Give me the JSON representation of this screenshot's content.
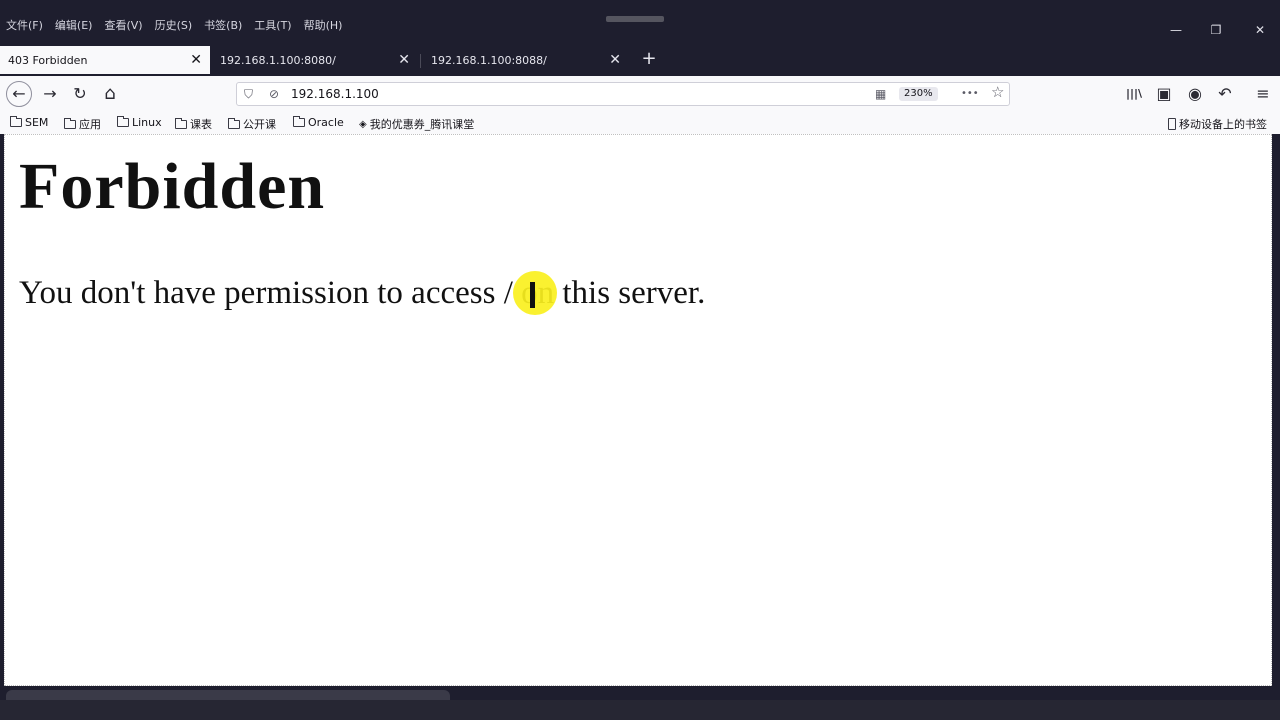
{
  "menu": {
    "items": [
      "文件(F)",
      "编辑(E)",
      "查看(V)",
      "历史(S)",
      "书签(B)",
      "工具(T)",
      "帮助(H)"
    ]
  },
  "window_controls": {
    "minimize": "—",
    "restore": "❐",
    "close": "✕"
  },
  "tabs": [
    {
      "label": "403 Forbidden",
      "active": true
    },
    {
      "label": "192.168.1.100:8080/",
      "active": false
    },
    {
      "label": "192.168.1.100:8088/",
      "active": false
    }
  ],
  "tab_close_glyph": "✕",
  "new_tab_glyph": "+",
  "nav": {
    "back": "←",
    "forward": "→",
    "reload": "↻",
    "home": "⌂"
  },
  "urlbar": {
    "url": "192.168.1.100",
    "zoom": "230%",
    "shield_icon": "shield-icon",
    "no-tracking-icon": "slashed-permission-icon"
  },
  "urlbar_icons": {
    "shield": "⛉",
    "permission": "⊘",
    "qr": "▦",
    "more": "•••",
    "star": "☆"
  },
  "toolbar_right_icons": {
    "library": "|||\\",
    "sidebar": "▣",
    "account": "◉",
    "undo": "↶",
    "menu": "≡"
  },
  "bookmarks": {
    "items": [
      "SEM",
      "应用",
      "Linux",
      "课表",
      "公开课",
      "Oracle",
      "我的优惠券_腾讯课堂"
    ],
    "mobile": "移动设备上的书签"
  },
  "page": {
    "heading": "Forbidden",
    "message": "You don't have permission to access / on this server."
  },
  "colors": {
    "chrome_dark": "#1e1e2e",
    "toolbar_light": "#f9f9fb",
    "cursor_highlight": "#faf01e"
  }
}
